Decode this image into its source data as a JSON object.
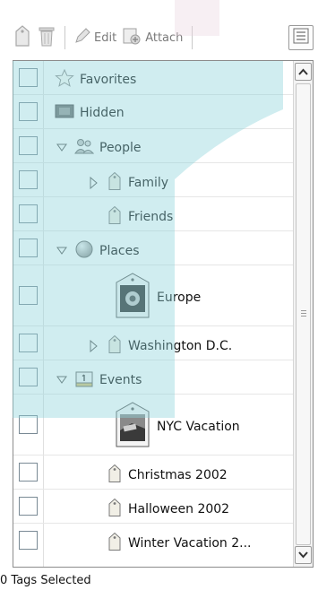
{
  "toolbar": {
    "edit_label": "Edit",
    "attach_label": "Attach"
  },
  "tags": [
    {
      "label": "Favorites"
    },
    {
      "label": "Hidden"
    },
    {
      "label": "People"
    },
    {
      "label": "Family"
    },
    {
      "label": "Friends"
    },
    {
      "label": "Places"
    },
    {
      "label": "Europe"
    },
    {
      "label": "Washington D.C."
    },
    {
      "label": "Events"
    },
    {
      "label": "NYC Vacation"
    },
    {
      "label": "Christmas 2002"
    },
    {
      "label": "Halloween 2002"
    },
    {
      "label": "Winter Vacation 2..."
    }
  ],
  "status": {
    "text": "0 Tags Selected"
  },
  "colors": {
    "watermark": "#8fd3dc",
    "tag_icon": "#f1efe6"
  }
}
